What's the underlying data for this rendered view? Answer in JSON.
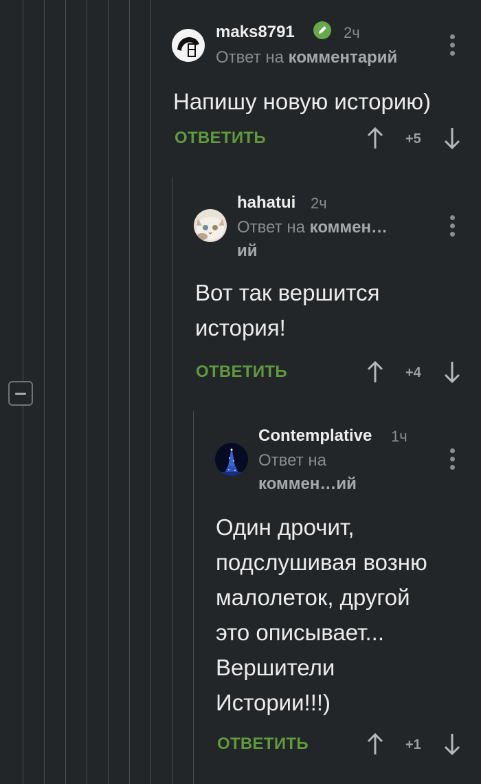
{
  "colors": {
    "background": "#232628",
    "thread_line": "#4a4e51",
    "reply_green": "#5f9a3d",
    "verified_green": "#67a94a",
    "meta_gray": "#888c90"
  },
  "thread": {
    "collapse_icon": "minus-square-icon"
  },
  "comments": [
    {
      "username": "maks8791",
      "time": "2ч",
      "verified": true,
      "reply_prefix": "Ответ на",
      "reply_target": "комментарий",
      "text_lines": [
        "Напишу новую историю)"
      ],
      "reply_label": "ОТВЕТИТЬ",
      "score": "+5"
    },
    {
      "username": "hahatui",
      "time": "2ч",
      "reply_prefix": "Ответ на",
      "reply_target_line1": "коммен…",
      "reply_target_line2": "ий",
      "text_lines": [
        "Вот так вершится",
        "история!"
      ],
      "reply_label": "ОТВЕТИТЬ",
      "score": "+4"
    },
    {
      "username": "Contemplative",
      "time": "1ч",
      "reply_prefix": "Ответ на",
      "reply_target": "коммен…ий",
      "text_lines": [
        "Один дрочит,",
        "подслушивая возню",
        "малолеток, другой",
        "это описывает...",
        "Вершители",
        "Истории!!!)"
      ],
      "reply_label": "ОТВЕТИТЬ",
      "score": "+1"
    }
  ]
}
